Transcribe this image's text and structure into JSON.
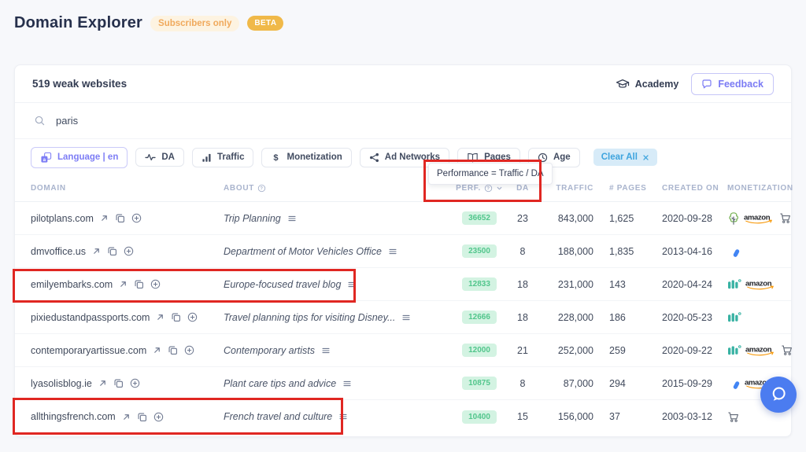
{
  "page": {
    "title": "Domain Explorer",
    "subscribers_badge": "Subscribers only",
    "beta_badge": "BETA"
  },
  "card": {
    "count_label": "519 weak websites",
    "academy_label": "Academy",
    "feedback_label": "Feedback",
    "search": {
      "value": "paris"
    }
  },
  "filters": {
    "language": "Language | en",
    "da": "DA",
    "traffic": "Traffic",
    "monetization": "Monetization",
    "ad_networks": "Ad Networks",
    "pages": "Pages",
    "age": "Age",
    "clear_all": "Clear All"
  },
  "tooltip": {
    "text": "Performance = Traffic / DA"
  },
  "table": {
    "columns": {
      "domain": "DOMAIN",
      "about": "ABOUT",
      "perf": "PERF.",
      "da": "DA",
      "traffic": "TRAFFIC",
      "pages": "# PAGES",
      "created": "CREATED ON",
      "monetization": "MONETIZATION"
    },
    "rows": [
      {
        "domain": "pilotplans.com",
        "about": "Trip Planning",
        "perf": "36652",
        "da": "23",
        "traffic": "843,000",
        "pages": "1,625",
        "created": "2020-09-28",
        "monetization": [
          "tree",
          "amazon",
          "cart"
        ]
      },
      {
        "domain": "dmvoffice.us",
        "about": "Department of Motor Vehicles Office",
        "perf": "23500",
        "da": "8",
        "traffic": "188,000",
        "pages": "1,835",
        "created": "2013-04-16",
        "monetization": [
          "adsense"
        ]
      },
      {
        "domain": "emilyembarks.com",
        "about": "Europe-focused travel blog",
        "perf": "12833",
        "da": "18",
        "traffic": "231,000",
        "pages": "143",
        "created": "2020-04-24",
        "monetization": [
          "mediavine",
          "amazon"
        ]
      },
      {
        "domain": "pixiedustandpassports.com",
        "about": "Travel planning tips for visiting Disney...",
        "perf": "12666",
        "da": "18",
        "traffic": "228,000",
        "pages": "186",
        "created": "2020-05-23",
        "monetization": [
          "mediavine"
        ]
      },
      {
        "domain": "contemporaryartissue.com",
        "about": "Contemporary artists",
        "perf": "12000",
        "da": "21",
        "traffic": "252,000",
        "pages": "259",
        "created": "2020-09-22",
        "monetization": [
          "mediavine",
          "amazon",
          "cart"
        ]
      },
      {
        "domain": "lyasolisblog.ie",
        "about": "Plant care tips and advice",
        "perf": "10875",
        "da": "8",
        "traffic": "87,000",
        "pages": "294",
        "created": "2015-09-29",
        "monetization": [
          "adsense",
          "amazon"
        ]
      },
      {
        "domain": "allthingsfrench.com",
        "about": "French travel and culture",
        "perf": "10400",
        "da": "15",
        "traffic": "156,000",
        "pages": "37",
        "created": "2003-03-12",
        "monetization": [
          "cart"
        ]
      }
    ]
  },
  "annotations": {
    "count": 3,
    "color": "#e02722"
  },
  "colors": {
    "accent_purple": "#7d7df5",
    "beta_orange": "#f0b949",
    "subscribers_orange": "#f0a95c",
    "clear_chip_blue": "#3ea4de",
    "badge_green": "#52c68c",
    "annotation_red": "#e02722",
    "chat_blue": "#4b7cf0"
  }
}
